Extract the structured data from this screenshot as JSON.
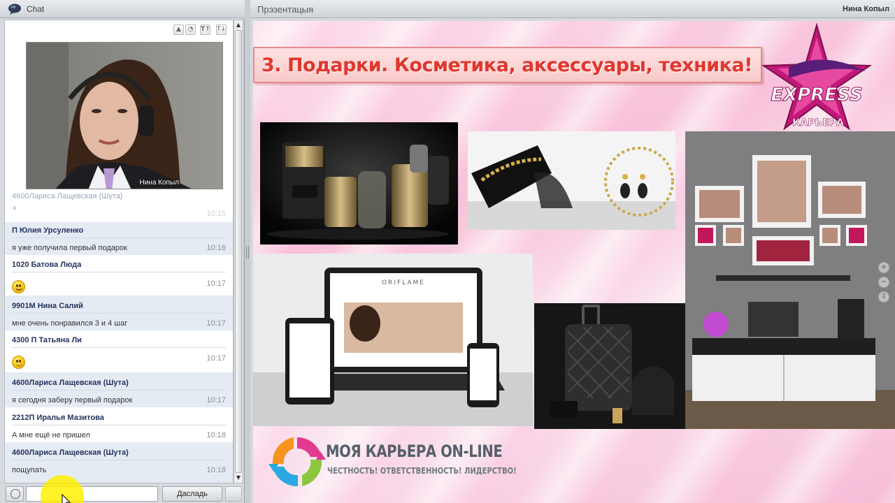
{
  "chat": {
    "title": "Chat",
    "webcam_name": "Нина Копыл",
    "messages": [
      {
        "author": "4600Лариса Лащевская (Шута)",
        "text": "",
        "time": "10:15",
        "faded": true
      },
      {
        "author": "П Юлия Урсуленко",
        "text": "я уже получила первый подарок",
        "time": "10:16"
      },
      {
        "author": "1020 Батова Люда",
        "emoji": "grin-face",
        "time": "10:17"
      },
      {
        "author": "9901М Нина Салий",
        "text": "мне очень понравился 3 и 4 шаг",
        "time": "10:17"
      },
      {
        "author": "4300 П Татьяна Ли",
        "emoji": "smile-face",
        "time": "10:17"
      },
      {
        "author": "4600Лариса Лащевская (Шута)",
        "text": "я сегодня заберу  первый подарок",
        "time": "10:17"
      },
      {
        "author": "2212П Иралья Мазитова",
        "text": "А мне ещё не пришел",
        "time": "10:18"
      },
      {
        "author": "4600Лариса Лащевская (Шута)",
        "text": "пощупать",
        "time": "10:18"
      }
    ],
    "input_value": "",
    "send_label": "Дасладь"
  },
  "presentation": {
    "title": "Прэзентацыя",
    "presenter": "Нина Копыл",
    "slide_title": "3. Подарки. Косметика, аксессуары, техника!",
    "logo_express": "EXPRESS",
    "logo_karera": "КАРЬЕРА",
    "brand": "МОЯ КАРЬЕРА ON-LINE",
    "tagline": "ЧЕСТНОСТЬ! ОТВЕТСТВЕННОСТЬ! ЛИДЕРСТВО!",
    "laptop_brand": "ORIFLAME"
  },
  "colors": {
    "slide_title": "#e0372d",
    "author": "#25325f",
    "accent_pink": "#c2187a"
  }
}
